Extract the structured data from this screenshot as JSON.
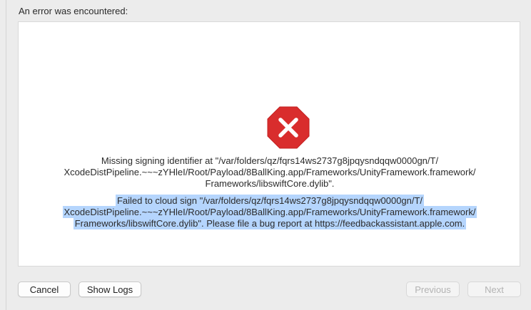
{
  "header": {
    "title": "An error was encountered:"
  },
  "error": {
    "icon": "stop-error-icon",
    "icon_color": "#d92d2d",
    "message1_lines": [
      "Missing signing identifier at \"/var/folders/qz/fqrs14ws2737g8jpqysndqqw0000gn/T/",
      "XcodeDistPipeline.~~~zYHleI/Root/Payload/8BallKing.app/Frameworks/UnityFramework.framework/",
      "Frameworks/libswiftCore.dylib\"."
    ],
    "message2_lines": [
      "Failed to cloud sign \"/var/folders/qz/fqrs14ws2737g8jpqysndqqw0000gn/T/",
      "XcodeDistPipeline.~~~zYHleI/Root/Payload/8BallKing.app/Frameworks/UnityFramework.framework/",
      "Frameworks/libswiftCore.dylib\". Please file a bug report at https://feedbackassistant.apple.com."
    ],
    "selection_color": "#b5d5fd"
  },
  "buttons": {
    "cancel": "Cancel",
    "show_logs": "Show Logs",
    "previous": "Previous",
    "next": "Next"
  }
}
